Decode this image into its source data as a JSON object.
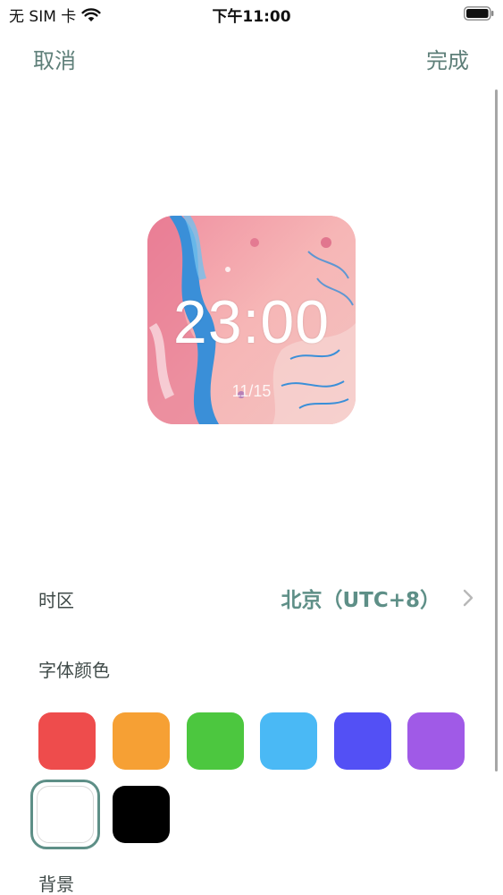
{
  "status_bar": {
    "carrier": "无 SIM 卡",
    "time": "下午11:00"
  },
  "nav": {
    "cancel_label": "取消",
    "done_label": "完成"
  },
  "widget": {
    "time": "23:00",
    "date": "11/15"
  },
  "settings": {
    "timezone_label": "时区",
    "timezone_value": "北京（UTC+8）",
    "font_color_label": "字体颜色",
    "background_label": "背景"
  },
  "colors": {
    "accent": "#5e8f87",
    "swatches": [
      "#ee4c4c",
      "#f6a034",
      "#4cc73f",
      "#4ab9f5",
      "#5350f5",
      "#a05ae7",
      "#ffffff",
      "#000000"
    ],
    "selected_swatch": "#ffffff"
  }
}
